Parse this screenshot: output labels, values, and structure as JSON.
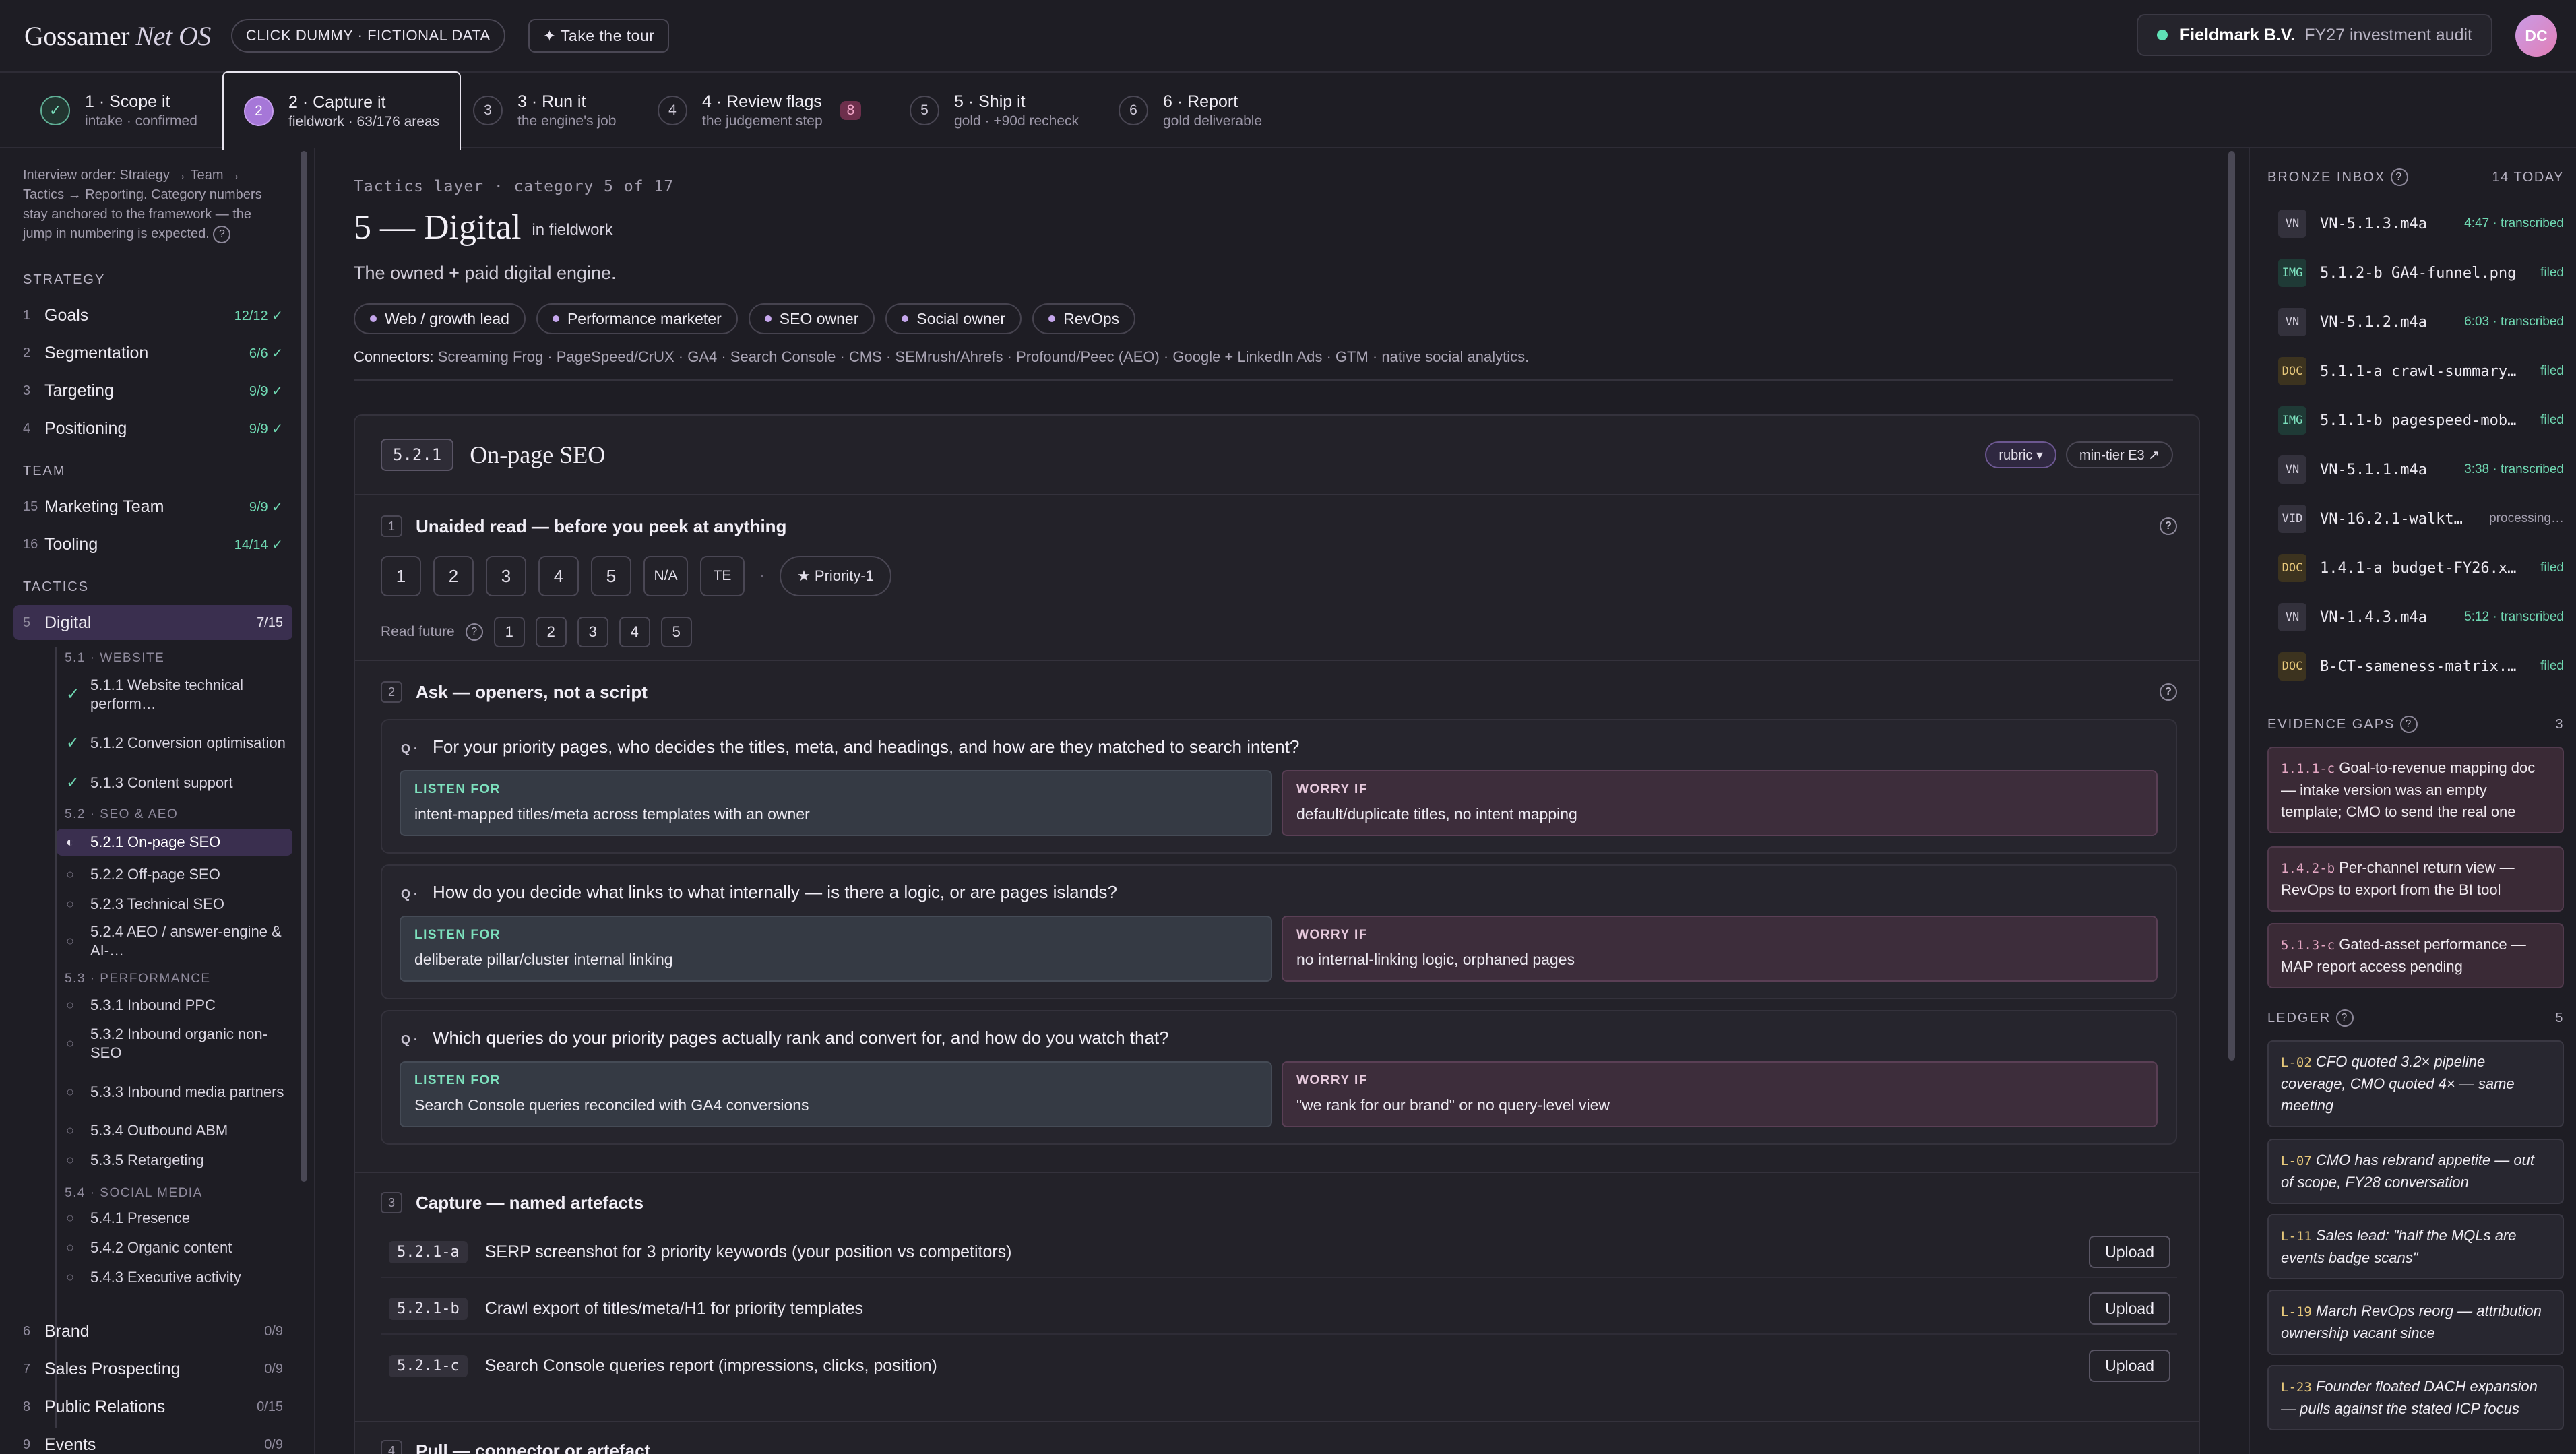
{
  "header": {
    "brand_main": "Gossamer",
    "brand_em": "Net OS",
    "dummy_badge": "CLICK DUMMY · FICTIONAL DATA",
    "tour_button": "✦ Take the tour",
    "client_name": "Fieldmark B.V.",
    "audit_name": "FY27 investment audit",
    "avatar_initials": "DC",
    "status_color": "#5fe0b5"
  },
  "steps": [
    {
      "num": "✓",
      "title": "1 · Scope it",
      "sub": "intake · confirmed"
    },
    {
      "num": "2",
      "title": "2 · Capture it",
      "sub": "fieldwork · 63/176 areas"
    },
    {
      "num": "3",
      "title": "3 · Run it",
      "sub": "the engine's job"
    },
    {
      "num": "4",
      "title": "4 · Review flags",
      "sub": "the judgement step",
      "badge": "8"
    },
    {
      "num": "5",
      "title": "5 · Ship it",
      "sub": "gold · +90d recheck"
    },
    {
      "num": "6",
      "title": "6 · Report",
      "sub": "gold deliverable"
    }
  ],
  "sidebar": {
    "intro": "Interview order: Strategy → Team → Tactics → Reporting. Category numbers stay anchored to the framework — the jump in numbering is expected.",
    "sections": {
      "strategy": "STRATEGY",
      "team": "TEAM",
      "tactics": "TACTICS"
    },
    "categories": [
      {
        "n": "1",
        "label": "Goals",
        "count": "12/12 ✓"
      },
      {
        "n": "2",
        "label": "Segmentation",
        "count": "6/6 ✓"
      },
      {
        "n": "3",
        "label": "Targeting",
        "count": "9/9 ✓"
      },
      {
        "n": "4",
        "label": "Positioning",
        "count": "9/9 ✓"
      },
      {
        "n": "15",
        "label": "Marketing Team",
        "count": "9/9 ✓"
      },
      {
        "n": "16",
        "label": "Tooling",
        "count": "14/14 ✓"
      },
      {
        "n": "5",
        "label": "Digital",
        "count": "7/15"
      },
      {
        "n": "6",
        "label": "Brand",
        "count": "0/9"
      },
      {
        "n": "7",
        "label": "Sales Prospecting",
        "count": "0/9"
      },
      {
        "n": "8",
        "label": "Public Relations",
        "count": "0/15"
      },
      {
        "n": "9",
        "label": "Events",
        "count": "0/9"
      }
    ],
    "subgroups": [
      "5.1 · WEBSITE",
      "5.2 · SEO & AEO",
      "5.3 · PERFORMANCE",
      "5.4 · SOCIAL MEDIA"
    ],
    "leaves": [
      {
        "icon": "✓",
        "label": "5.1.1 Website technical perform…"
      },
      {
        "icon": "✓",
        "label": "5.1.2 Conversion optimisation"
      },
      {
        "icon": "✓",
        "label": "5.1.3 Content support"
      },
      {
        "icon": "◐",
        "label": "5.2.1 On-page SEO"
      },
      {
        "icon": "○",
        "label": "5.2.2 Off-page SEO"
      },
      {
        "icon": "○",
        "label": "5.2.3 Technical SEO"
      },
      {
        "icon": "○",
        "label": "5.2.4 AEO / answer-engine & AI-…"
      },
      {
        "icon": "○",
        "label": "5.3.1 Inbound PPC"
      },
      {
        "icon": "○",
        "label": "5.3.2 Inbound organic non-SEO"
      },
      {
        "icon": "○",
        "label": "5.3.3 Inbound media partners"
      },
      {
        "icon": "○",
        "label": "5.3.4 Outbound ABM"
      },
      {
        "icon": "○",
        "label": "5.3.5 Retargeting"
      },
      {
        "icon": "○",
        "label": "5.4.1 Presence"
      },
      {
        "icon": "○",
        "label": "5.4.2 Organic content"
      },
      {
        "icon": "○",
        "label": "5.4.3 Executive activity"
      }
    ]
  },
  "main": {
    "crumb": "Tactics layer · category 5 of 17",
    "title": "5 — Digital",
    "status": "in fieldwork",
    "lead": "The owned + paid digital engine.",
    "roles": [
      "Web / growth lead",
      "Performance marketer",
      "SEO owner",
      "Social owner",
      "RevOps"
    ],
    "connectors_label": "Connectors:",
    "connectors": "Screaming Frog · PageSpeed/CrUX · GA4 · Search Console · CMS · SEMrush/Ahrefs · Profound/Peec (AEO) · Google + LinkedIn Ads · GTM · native social analytics.",
    "card": {
      "code": "5.2.1",
      "title": "On-page SEO",
      "rubric": "rubric ▾",
      "mintier": "min-tier E3 ↗",
      "b1": {
        "n": "1",
        "title": "Unaided read — before you peek at anything",
        "ratings": [
          "1",
          "2",
          "3",
          "4",
          "5",
          "N/A",
          "TE"
        ],
        "priority": "★ Priority-1",
        "future_label": "Read future",
        "future": [
          "1",
          "2",
          "3",
          "4",
          "5"
        ]
      },
      "b2": {
        "n": "2",
        "title": "Ask — openers, not a script",
        "listen_label": "LISTEN FOR",
        "worry_label": "WORRY IF",
        "q_label": "Q ·",
        "questions": [
          {
            "q": "For your priority pages, who decides the titles, meta, and headings, and how are they matched to search intent?",
            "listen": "intent-mapped titles/meta across templates with an owner",
            "worry": "default/duplicate titles, no intent mapping"
          },
          {
            "q": "How do you decide what links to what internally — is there a logic, or are pages islands?",
            "listen": "deliberate pillar/cluster internal linking",
            "worry": "no internal-linking logic, orphaned pages"
          },
          {
            "q": "Which queries do your priority pages actually rank and convert for, and how do you watch that?",
            "listen": "Search Console queries reconciled with GA4 conversions",
            "worry": "\"we rank for our brand\" or no query-level view"
          }
        ]
      },
      "b3": {
        "n": "3",
        "title": "Capture — named artefacts",
        "upload_label": "Upload",
        "artefacts": [
          {
            "code": "5.2.1-a",
            "title": "SERP screenshot for 3 priority keywords (your position vs competitors)"
          },
          {
            "code": "5.2.1-b",
            "title": "Crawl export of titles/meta/H1 for priority templates"
          },
          {
            "code": "5.2.1-c",
            "title": "Search Console queries report (impressions, clicks, position)"
          }
        ]
      },
      "b4": {
        "n": "4",
        "title": "Pull — connector or artefact"
      }
    }
  },
  "right": {
    "inbox_title": "BRONZE INBOX",
    "inbox_count": "14 TODAY",
    "inbox": [
      {
        "tag": "VN",
        "name": "VN-5.1.3.m4a",
        "status": "4:47 · transcribed"
      },
      {
        "tag": "IMG",
        "name": "5.1.2-b GA4-funnel.png",
        "status": "filed"
      },
      {
        "tag": "VN",
        "name": "VN-5.1.2.m4a",
        "status": "6:03 · transcribed"
      },
      {
        "tag": "DOC",
        "name": "5.1.1-a crawl-summary…",
        "status": "filed"
      },
      {
        "tag": "IMG",
        "name": "5.1.1-b pagespeed-mob…",
        "status": "filed"
      },
      {
        "tag": "VN",
        "name": "VN-5.1.1.m4a",
        "status": "3:38 · transcribed"
      },
      {
        "tag": "VID",
        "name": "VN-16.2.1-walkt…",
        "status": "processing…"
      },
      {
        "tag": "DOC",
        "name": "1.4.1-a budget-FY26.x…",
        "status": "filed"
      },
      {
        "tag": "VN",
        "name": "VN-1.4.3.m4a",
        "status": "5:12 · transcribed"
      },
      {
        "tag": "DOC",
        "name": "B-CT-sameness-matrix.…",
        "status": "filed"
      }
    ],
    "gaps_title": "EVIDENCE GAPS",
    "gaps_count": "3",
    "gaps": [
      {
        "code": "1.1.1-c",
        "text": "Goal-to-revenue mapping doc — intake version was an empty template; CMO to send the real one"
      },
      {
        "code": "1.4.2-b",
        "text": "Per-channel return view — RevOps to export from the BI tool"
      },
      {
        "code": "5.1.3-c",
        "text": "Gated-asset performance — MAP report access pending"
      }
    ],
    "ledger_title": "LEDGER",
    "ledger_count": "5",
    "ledger": [
      {
        "code": "L-02",
        "text": "CFO quoted 3.2× pipeline coverage, CMO quoted 4× — same meeting"
      },
      {
        "code": "L-07",
        "text": "CMO has rebrand appetite — out of scope, FY28 conversation"
      },
      {
        "code": "L-11",
        "text": "Sales lead: \"half the MQLs are events badge scans\""
      },
      {
        "code": "L-19",
        "text": "March RevOps reorg — attribution ownership vacant since"
      },
      {
        "code": "L-23",
        "text": "Founder floated DACH expansion — pulls against the stated ICP focus"
      }
    ]
  }
}
